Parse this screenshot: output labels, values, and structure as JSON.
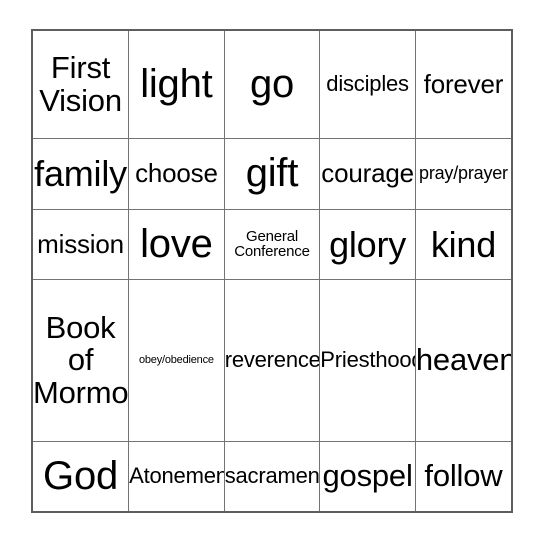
{
  "card": {
    "type": "bingo-card",
    "rows": 5,
    "columns": 5,
    "border_color": "#5e5e5e",
    "grid_line_color": "#737373",
    "background_color": "#ffffff",
    "text_color": "#000000",
    "cells": [
      [
        {
          "text": "First\nVision",
          "size": "fs-l"
        },
        {
          "text": "light",
          "size": "fs-xxl"
        },
        {
          "text": "go",
          "size": "fs-xxl"
        },
        {
          "text": "disciples",
          "size": "fs-s"
        },
        {
          "text": "forever",
          "size": "fs-m"
        }
      ],
      [
        {
          "text": "family",
          "size": "fs-xl"
        },
        {
          "text": "choose",
          "size": "fs-m"
        },
        {
          "text": "gift",
          "size": "fs-xxl"
        },
        {
          "text": "courage",
          "size": "fs-m"
        },
        {
          "text": "pray/prayer",
          "size": "fs-xs"
        }
      ],
      [
        {
          "text": "mission",
          "size": "fs-m"
        },
        {
          "text": "love",
          "size": "fs-xxl"
        },
        {
          "text": "General\nConference",
          "size": "fs-xxs"
        },
        {
          "text": "glory",
          "size": "fs-xl"
        },
        {
          "text": "kind",
          "size": "fs-xl"
        }
      ],
      [
        {
          "text": "Book of\nMormon",
          "size": "fs-l"
        },
        {
          "text": "obey/obedience",
          "size": "fs-tiny"
        },
        {
          "text": "reverence",
          "size": "fs-s"
        },
        {
          "text": "Priesthood",
          "size": "fs-s"
        },
        {
          "text": "heaven",
          "size": "fs-l"
        }
      ],
      [
        {
          "text": "God",
          "size": "fs-xxl"
        },
        {
          "text": "Atonement",
          "size": "fs-s"
        },
        {
          "text": "sacrament",
          "size": "fs-s"
        },
        {
          "text": "gospel",
          "size": "fs-l"
        },
        {
          "text": "follow",
          "size": "fs-l"
        }
      ]
    ]
  }
}
